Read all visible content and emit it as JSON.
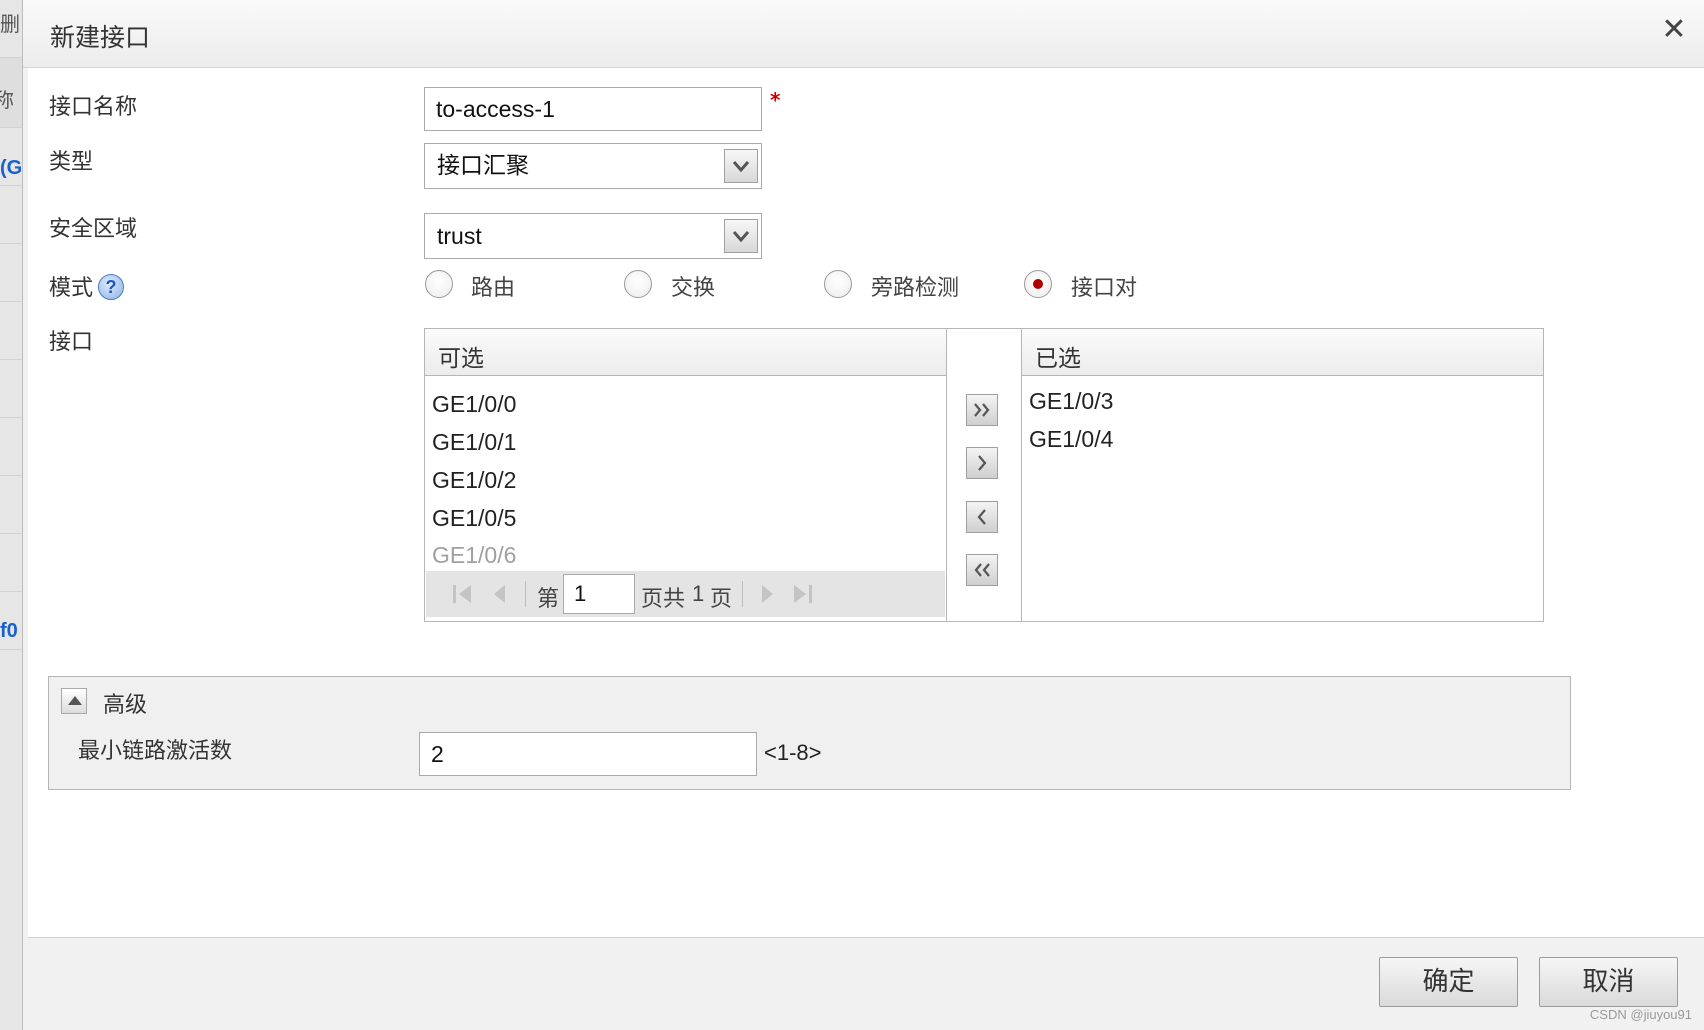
{
  "background": {
    "texts": [
      {
        "text": "删",
        "color": "gray"
      },
      {
        "text": "称",
        "color": "gray"
      },
      {
        "text": "(G",
        "color": "blue"
      },
      {
        "text": "f0",
        "color": "blue"
      }
    ]
  },
  "dialog": {
    "title": "新建接口",
    "close_symbol": "✕",
    "form": {
      "name": {
        "label": "接口名称",
        "value": "to-access-1",
        "required_mark": "*"
      },
      "type": {
        "label": "类型",
        "value": "接口汇聚"
      },
      "zone": {
        "label": "安全区域",
        "value": "trust"
      },
      "mode": {
        "label": "模式",
        "help_symbol": "?",
        "options": [
          {
            "label": "路由",
            "checked": false
          },
          {
            "label": "交换",
            "checked": false
          },
          {
            "label": "旁路检测",
            "checked": false
          },
          {
            "label": "接口对",
            "checked": true
          }
        ]
      },
      "interface": {
        "label": "接口",
        "available": {
          "header": "可选",
          "items": [
            "GE1/0/0",
            "GE1/0/1",
            "GE1/0/2",
            "GE1/0/5",
            "GE1/0/6"
          ]
        },
        "selected": {
          "header": "已选",
          "items": [
            "GE1/0/3",
            "GE1/0/4"
          ]
        },
        "pager": {
          "prefix": "第",
          "page": "1",
          "middle": "页共",
          "total": "1",
          "suffix": "页"
        }
      }
    },
    "advanced": {
      "title": "高级",
      "min_links": {
        "label": "最小链路激活数",
        "value": "2",
        "range": "<1-8>"
      }
    },
    "footer": {
      "ok": "确定",
      "cancel": "取消"
    }
  },
  "watermark": "CSDN @jiuyou91",
  "colors": {
    "accent_red": "#b00000",
    "link_blue": "#1a5fcc"
  }
}
